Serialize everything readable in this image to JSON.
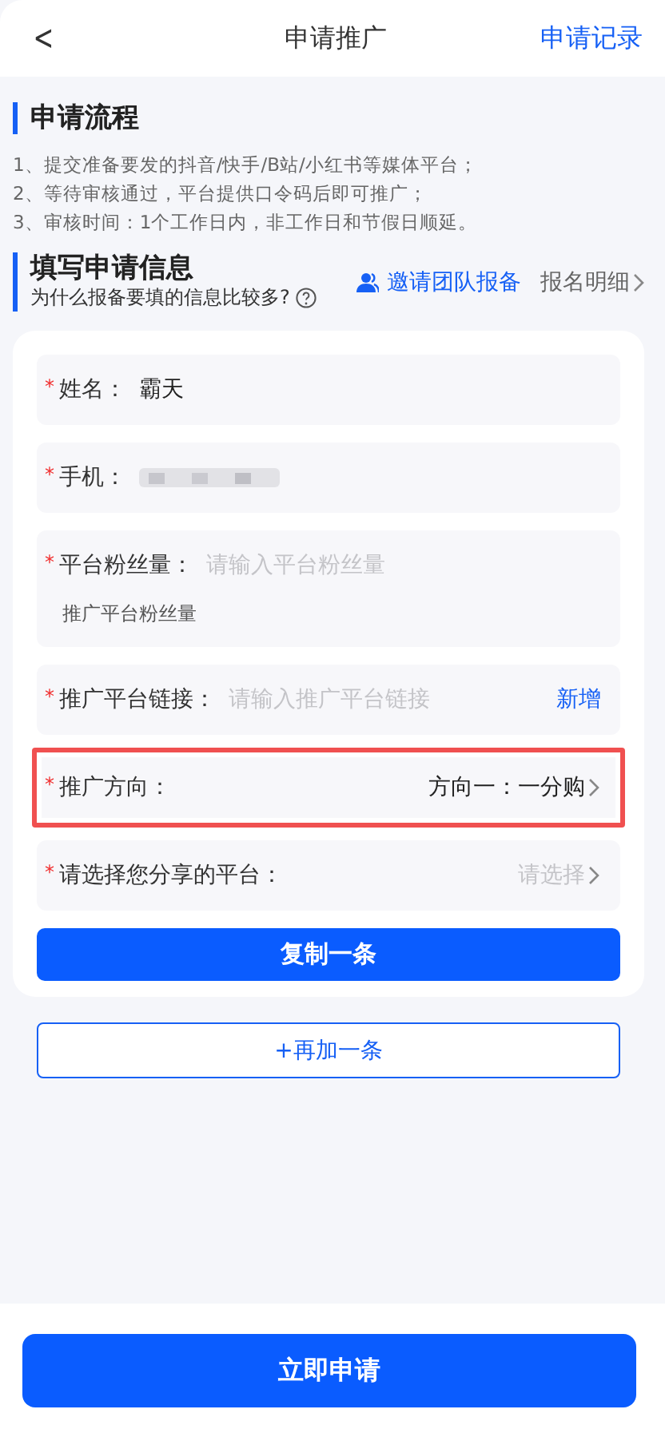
{
  "header": {
    "back": "<",
    "title": "申请推广",
    "action": "申请记录"
  },
  "process": {
    "title": "申请流程",
    "steps": [
      "1、提交准备要发的抖音/快手/B站/小红书等媒体平台；",
      "2、等待审核通过，平台提供口令码后即可推广；",
      "3、审核时间：1个工作日内，非工作日和节假日顺延。"
    ]
  },
  "form_section": {
    "title": "填写申请信息",
    "subtitle": "为什么报备要填的信息比较多?",
    "invite": "邀请团队报备",
    "details": "报名明细"
  },
  "fields": [
    {
      "kind": "text",
      "required_mark": "*",
      "label": "姓名：",
      "value": "霸天",
      "highlighted": false
    },
    {
      "kind": "masked",
      "required_mark": "*",
      "label": "手机：",
      "highlighted": false
    },
    {
      "kind": "input",
      "required_mark": "*",
      "label": "平台粉丝量：",
      "placeholder": "请输入平台粉丝量",
      "note": "推广平台粉丝量",
      "highlighted": false
    },
    {
      "kind": "link",
      "required_mark": "*",
      "label": "推广平台链接：",
      "placeholder": "请输入推广平台链接",
      "action": "新增",
      "highlighted": false
    },
    {
      "kind": "select",
      "required_mark": "*",
      "label": "推广方向：",
      "value": "方向一：一分购",
      "highlighted": true
    },
    {
      "kind": "select",
      "required_mark": "*",
      "label": "请选择您分享的平台：",
      "placeholder": "请选择",
      "highlighted": false
    }
  ],
  "copy_button": "复制一条",
  "add_button": "+再加一条",
  "submit_button": "立即申请"
}
